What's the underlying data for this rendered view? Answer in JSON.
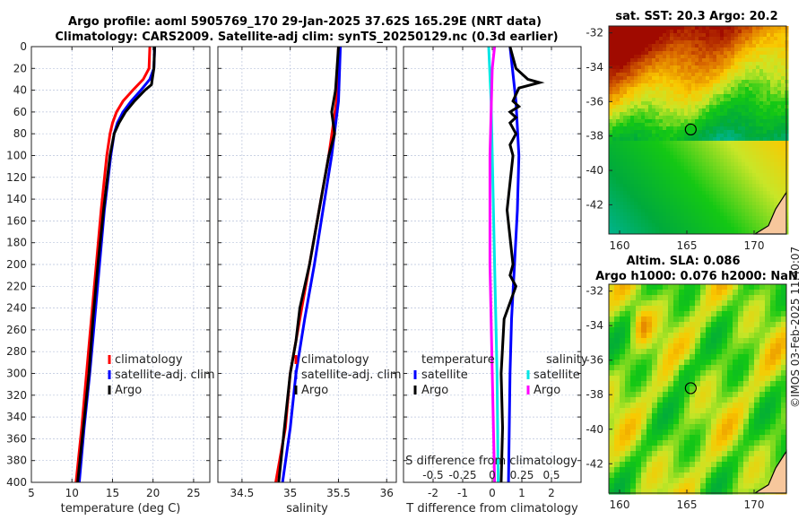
{
  "title": {
    "line1": "Argo profile: aoml 5905769_170 29-Jan-2025 37.62S 165.29E (NRT data)",
    "line2": "Climatology: CARS2009. Satellite-adj clim: synTS_20250129.nc (0.3d earlier)"
  },
  "credit": "©IMOS 03-Feb-2025 11:40:07",
  "colors": {
    "climatology": "#ff0000",
    "satellite": "#0000ff",
    "argo": "#000000",
    "s_satellite": "#00e5e5",
    "s_argo": "#ff00ff",
    "land": "#f7c79c"
  },
  "chart_data": [
    {
      "type": "line",
      "xlabel": "temperature (deg C)",
      "xlim": [
        5,
        27
      ],
      "ylim": [
        400,
        0
      ],
      "xticks": [
        "5",
        "10",
        "15",
        "20",
        "25"
      ],
      "yticks": [
        "0",
        "20",
        "40",
        "60",
        "80",
        "100",
        "120",
        "140",
        "160",
        "180",
        "200",
        "220",
        "240",
        "260",
        "280",
        "300",
        "320",
        "340",
        "360",
        "380",
        "400"
      ],
      "grid": true,
      "legend": [
        "climatology",
        "satellite-adj. clim",
        "Argo"
      ],
      "series": [
        {
          "name": "climatology",
          "color": "#ff0000",
          "depth": [
            0,
            20,
            30,
            40,
            50,
            60,
            70,
            80,
            100,
            150,
            200,
            250,
            300,
            350,
            400
          ],
          "values": [
            19.6,
            19.5,
            18.8,
            17.5,
            16.3,
            15.5,
            15.0,
            14.7,
            14.3,
            13.6,
            13.0,
            12.4,
            11.8,
            11.2,
            10.5
          ]
        },
        {
          "name": "satellite-adj. clim",
          "color": "#0000ff",
          "depth": [
            0,
            20,
            30,
            40,
            50,
            60,
            70,
            80,
            100,
            150,
            200,
            250,
            300,
            350,
            400
          ],
          "values": [
            20.2,
            20.1,
            19.6,
            18.5,
            17.3,
            16.3,
            15.6,
            15.2,
            14.8,
            14.0,
            13.4,
            12.8,
            12.2,
            11.5,
            10.9
          ]
        },
        {
          "name": "Argo",
          "color": "#000000",
          "depth": [
            0,
            20,
            35,
            40,
            50,
            60,
            70,
            80,
            100,
            150,
            200,
            250,
            300,
            350,
            400
          ],
          "values": [
            20.2,
            20.1,
            19.8,
            19.0,
            17.7,
            16.6,
            15.8,
            15.2,
            14.7,
            13.9,
            13.2,
            12.6,
            12.1,
            11.4,
            10.7
          ]
        }
      ]
    },
    {
      "type": "line",
      "xlabel": "salinity",
      "xlim": [
        34.25,
        36.1
      ],
      "ylim": [
        400,
        0
      ],
      "xticks": [
        "34.5",
        "35",
        "35.5",
        "36"
      ],
      "grid": true,
      "legend": [
        "climatology",
        "satellite-adj. clim",
        "Argo"
      ],
      "series": [
        {
          "name": "climatology",
          "color": "#ff0000",
          "depth": [
            0,
            50,
            100,
            150,
            200,
            250,
            300,
            350,
            400
          ],
          "values": [
            35.5,
            35.48,
            35.4,
            35.3,
            35.2,
            35.1,
            35.0,
            34.95,
            34.85
          ]
        },
        {
          "name": "satellite-adj. clim",
          "color": "#0000ff",
          "depth": [
            0,
            50,
            100,
            150,
            200,
            250,
            300,
            350,
            400
          ],
          "values": [
            35.52,
            35.5,
            35.43,
            35.34,
            35.25,
            35.15,
            35.06,
            35.0,
            34.92
          ]
        },
        {
          "name": "Argo",
          "color": "#000000",
          "depth": [
            0,
            40,
            60,
            80,
            100,
            150,
            200,
            240,
            270,
            300,
            350,
            400
          ],
          "values": [
            35.5,
            35.47,
            35.43,
            35.46,
            35.4,
            35.3,
            35.2,
            35.1,
            35.06,
            35.0,
            34.94,
            34.88
          ]
        }
      ]
    },
    {
      "type": "line",
      "xlabel": "T difference from climatology",
      "x2label": "S difference from climatology",
      "xlim": [
        -3,
        3
      ],
      "x2lim": [
        -0.75,
        0.75
      ],
      "ylim": [
        400,
        0
      ],
      "xticks": [
        "-2",
        "-1",
        "0",
        "1",
        "2"
      ],
      "x2ticks": [
        "-0.5",
        "-0.25",
        "0",
        "0.25",
        "0.5"
      ],
      "grid": true,
      "legend_t_title": "temperature",
      "legend_s_title": "salinity",
      "legend_t": [
        "satellite",
        "Argo"
      ],
      "legend_s": [
        "satellite",
        "Argo"
      ],
      "series": [
        {
          "name": "satellite",
          "var": "T",
          "color": "#0000ff",
          "depth": [
            0,
            50,
            100,
            150,
            200,
            250,
            300,
            400
          ],
          "values": [
            0.6,
            0.8,
            0.9,
            0.85,
            0.75,
            0.65,
            0.6,
            0.55
          ]
        },
        {
          "name": "Argo",
          "var": "T",
          "color": "#000000",
          "depth": [
            0,
            20,
            30,
            33,
            38,
            50,
            55,
            60,
            65,
            70,
            80,
            90,
            100,
            150,
            200,
            210,
            220,
            250,
            300,
            350,
            400
          ],
          "values": [
            0.6,
            0.8,
            1.2,
            1.6,
            0.9,
            0.7,
            0.9,
            0.6,
            0.8,
            0.6,
            0.8,
            0.6,
            0.7,
            0.5,
            0.7,
            0.6,
            0.8,
            0.4,
            0.3,
            0.35,
            0.3
          ]
        },
        {
          "name": "satellite",
          "var": "S",
          "color": "#00e5e5",
          "depth": [
            0,
            50,
            100,
            200,
            300,
            400
          ],
          "values": [
            -0.03,
            -0.01,
            0.0,
            0.02,
            0.04,
            0.05
          ]
        },
        {
          "name": "Argo",
          "var": "S",
          "color": "#ff00ff",
          "depth": [
            0,
            20,
            60,
            100,
            200,
            300,
            400
          ],
          "values": [
            0.02,
            0.0,
            -0.01,
            -0.02,
            -0.02,
            0.0,
            0.02
          ]
        }
      ]
    },
    {
      "type": "heatmap",
      "title": "sat. SST: 20.3 Argo: 20.2",
      "lonlim": [
        159.2,
        172.4
      ],
      "latlim": [
        -43.7,
        -31.6
      ],
      "xticks": [
        "160",
        "165",
        "170"
      ],
      "yticks": [
        "-32",
        "-34",
        "-36",
        "-38",
        "-40",
        "-42"
      ],
      "marker": {
        "lon": 165.29,
        "lat": -37.62
      }
    },
    {
      "type": "heatmap",
      "title": "Altim. SLA: 0.086",
      "subtitle": "Argo h1000: 0.076 h2000: NaN",
      "lonlim": [
        159.2,
        172.4
      ],
      "latlim": [
        -43.7,
        -31.6
      ],
      "xticks": [
        "160",
        "165",
        "170"
      ],
      "yticks": [
        "-32",
        "-34",
        "-36",
        "-38",
        "-40",
        "-42"
      ],
      "marker": {
        "lon": 165.29,
        "lat": -37.62
      }
    }
  ]
}
